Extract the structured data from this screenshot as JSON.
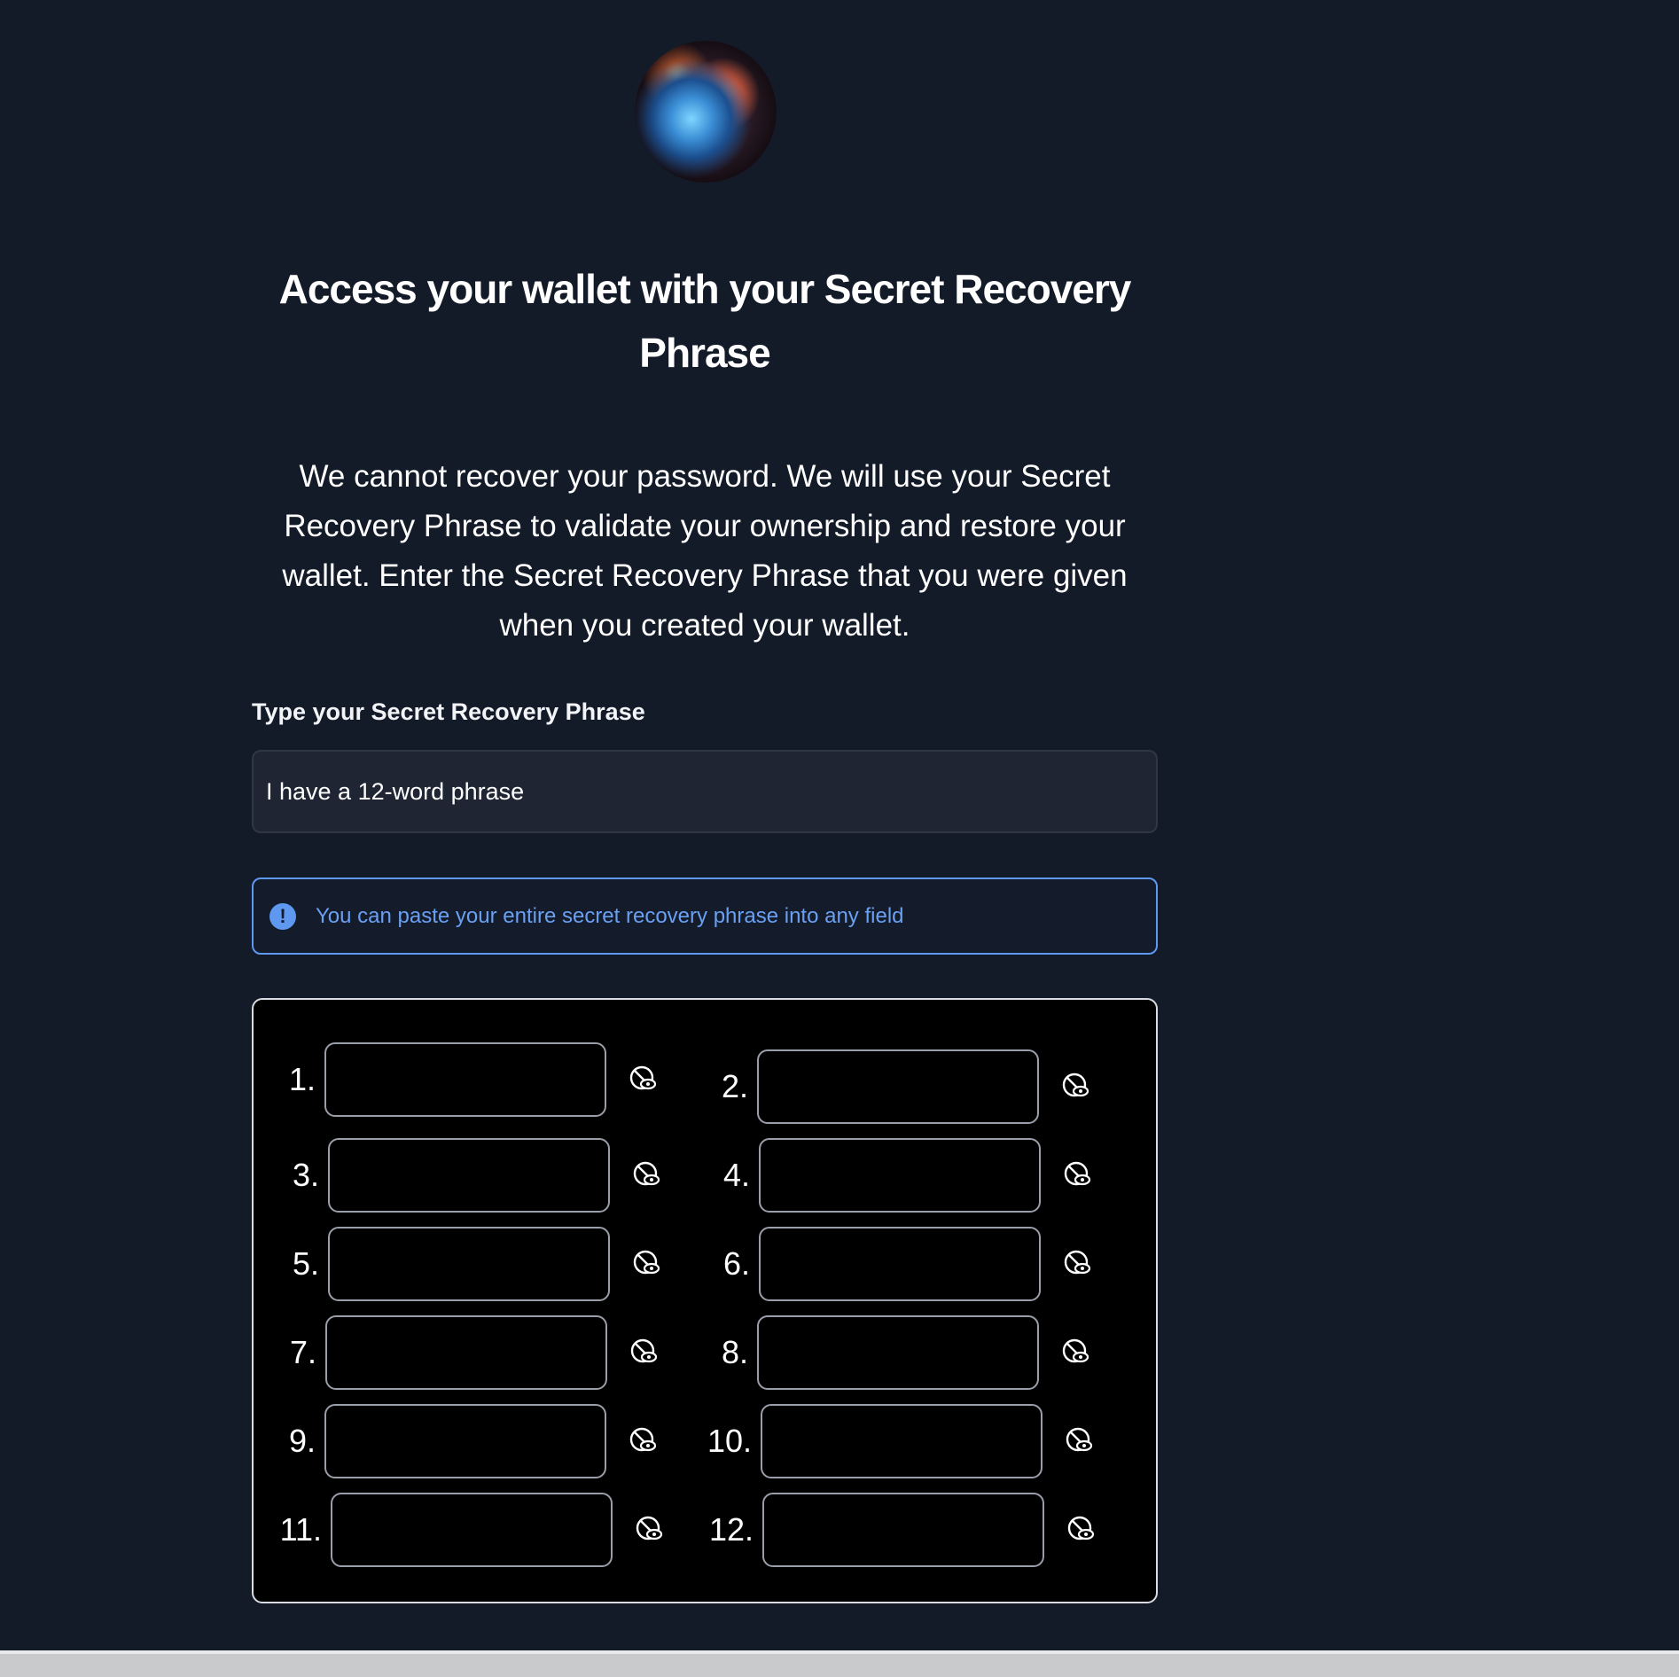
{
  "header": {
    "avatar_name": "nebula-avatar"
  },
  "title": "Access your wallet with your Secret Recovery Phrase",
  "description": "We cannot recover your password. We will use your Secret Recovery Phrase to validate your ownership and restore your wallet. Enter the Secret Recovery Phrase that you were given when you created your wallet.",
  "phrase": {
    "label": "Type your Secret Recovery Phrase",
    "selected_option": "I have a 12-word phrase"
  },
  "info": {
    "icon": "info-icon",
    "text": "You can paste your entire secret recovery phrase into any field"
  },
  "words": [
    {
      "number": "1.",
      "value": ""
    },
    {
      "number": "2.",
      "value": ""
    },
    {
      "number": "3.",
      "value": ""
    },
    {
      "number": "4.",
      "value": ""
    },
    {
      "number": "5.",
      "value": ""
    },
    {
      "number": "6.",
      "value": ""
    },
    {
      "number": "7.",
      "value": ""
    },
    {
      "number": "8.",
      "value": ""
    },
    {
      "number": "9.",
      "value": ""
    },
    {
      "number": "10.",
      "value": ""
    },
    {
      "number": "11.",
      "value": ""
    },
    {
      "number": "12.",
      "value": ""
    }
  ],
  "colors": {
    "background": "#131a28",
    "accent": "#5e98f0",
    "panel": "#000000"
  }
}
